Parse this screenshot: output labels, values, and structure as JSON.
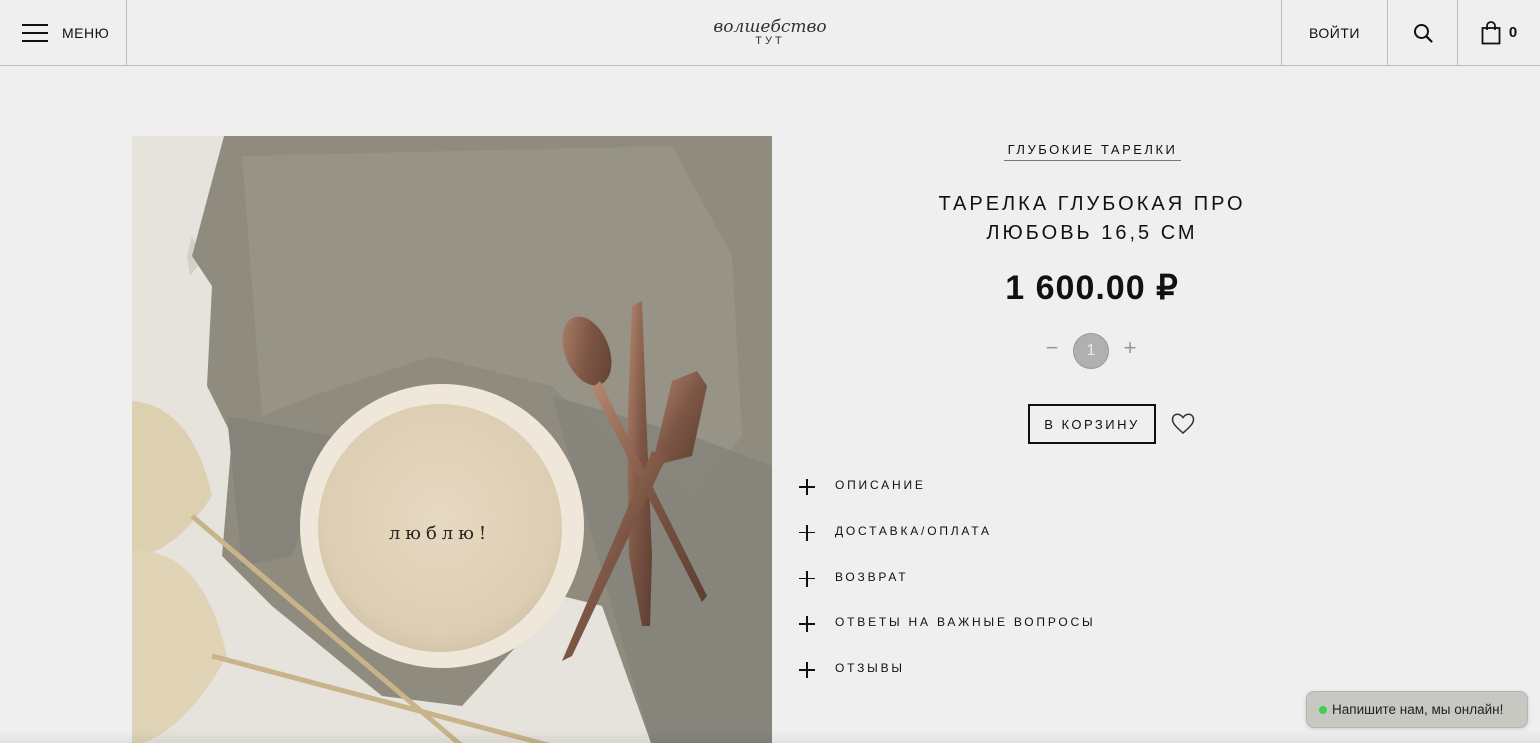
{
  "header": {
    "menu_label": "МЕНЮ",
    "logo_script": "волшебство",
    "logo_sub": "ТУТ",
    "login_label": "ВОЙТИ",
    "cart_count": "0",
    "icons": {
      "menu": "hamburger-icon",
      "search": "search-icon",
      "cart": "shopping-bag-icon"
    }
  },
  "product": {
    "image_text": "люблю!",
    "category": "ГЛУБОКИЕ ТАРЕЛКИ",
    "title_line1": "ТАРЕЛКА ГЛУБОКАЯ ПРО",
    "title_line2": "ЛЮБОВЬ 16,5 СМ",
    "price": "1 600.00 ₽",
    "quantity": {
      "minus_label": "−",
      "value": "1",
      "plus_label": "+"
    },
    "add_to_cart_label": "В КОРЗИНУ",
    "favorite_icon": "heart-icon"
  },
  "accordion": {
    "items": [
      {
        "label": "ОПИСАНИЕ"
      },
      {
        "label": "ДОСТАВКА/ОПЛАТА"
      },
      {
        "label": "ВОЗВРАТ"
      },
      {
        "label": "ОТВЕТЫ НА ВАЖНЫЕ ВОПРОСЫ"
      },
      {
        "label": "ОТЗЫВЫ"
      }
    ]
  },
  "chat_widget": {
    "label": "Напишите нам, мы онлайн!",
    "status_color": "#3fcf4c"
  }
}
